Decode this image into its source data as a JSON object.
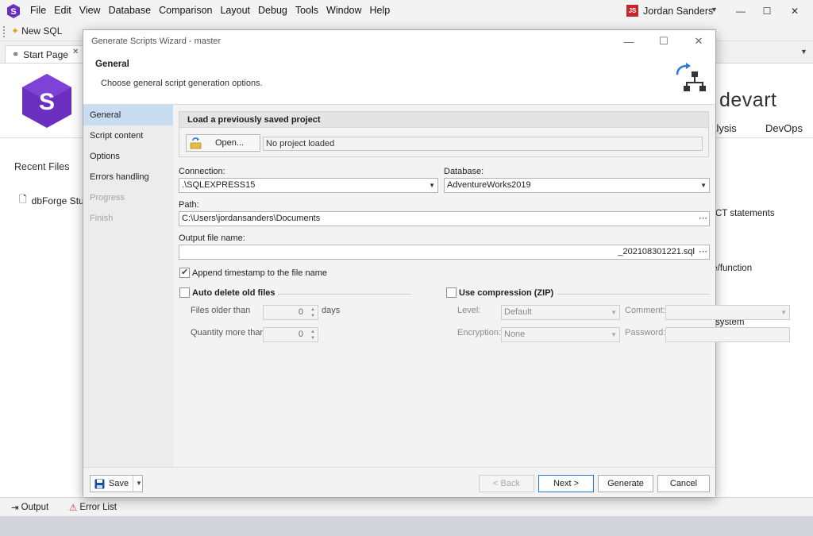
{
  "app": {
    "menu": [
      "File",
      "Edit",
      "View",
      "Database",
      "Comparison",
      "Layout",
      "Debug",
      "Tools",
      "Window",
      "Help"
    ],
    "user": {
      "initials": "JS",
      "name": "Jordan Sanders"
    },
    "toolbar": {
      "new_sql": "New SQL"
    },
    "start_tab": "Start Page",
    "start_page": {
      "recent_title": "Recent Files",
      "recent_item": "dbForge Stud",
      "brand": "devart",
      "nav_analysis": "nalysis",
      "nav_devops": "DevOps",
      "text1": "CT statements",
      "text2": "ure/function",
      "text3": "system"
    },
    "status": {
      "output": "Output",
      "error_list": "Error List"
    }
  },
  "dialog": {
    "title": "Generate Scripts Wizard - master",
    "header_title": "General",
    "header_subtitle": "Choose general script generation options.",
    "sidebar": [
      {
        "label": "General",
        "state": "active"
      },
      {
        "label": "Script content",
        "state": "normal"
      },
      {
        "label": "Options",
        "state": "normal"
      },
      {
        "label": "Errors handling",
        "state": "normal"
      },
      {
        "label": "Progress",
        "state": "disabled"
      },
      {
        "label": "Finish",
        "state": "disabled"
      }
    ],
    "load_project": {
      "title": "Load a previously saved project",
      "open_label": "Open...",
      "status": "No project loaded"
    },
    "connection": {
      "label": "Connection:",
      "value": ".\\SQLEXPRESS15"
    },
    "database": {
      "label": "Database:",
      "value": "AdventureWorks2019"
    },
    "path": {
      "label": "Path:",
      "value": "C:\\Users\\jordansanders\\Documents"
    },
    "output_file": {
      "label": "Output file name:",
      "value": "_202108301221.sql"
    },
    "append_timestamp": {
      "label": "Append timestamp to the file name",
      "checked": true
    },
    "auto_delete": {
      "label": "Auto delete old files",
      "checked": false,
      "files_older_label": "Files older than",
      "files_older_value": "0",
      "days_label": "days",
      "quantity_label": "Quantity more than",
      "quantity_value": "0"
    },
    "compression": {
      "label": "Use compression (ZIP)",
      "checked": false,
      "level_label": "Level:",
      "level_value": "Default",
      "encryption_label": "Encryption:",
      "encryption_value": "None",
      "comment_label": "Comment:",
      "comment_value": "",
      "password_label": "Password:",
      "password_value": ""
    },
    "buttons": {
      "save": "Save",
      "back": "< Back",
      "next": "Next >",
      "generate": "Generate",
      "cancel": "Cancel"
    }
  },
  "colors": {
    "accent": "#2a78d6",
    "brand_purple": "#6b2fbf",
    "active_nav": "#c9ddf2"
  }
}
